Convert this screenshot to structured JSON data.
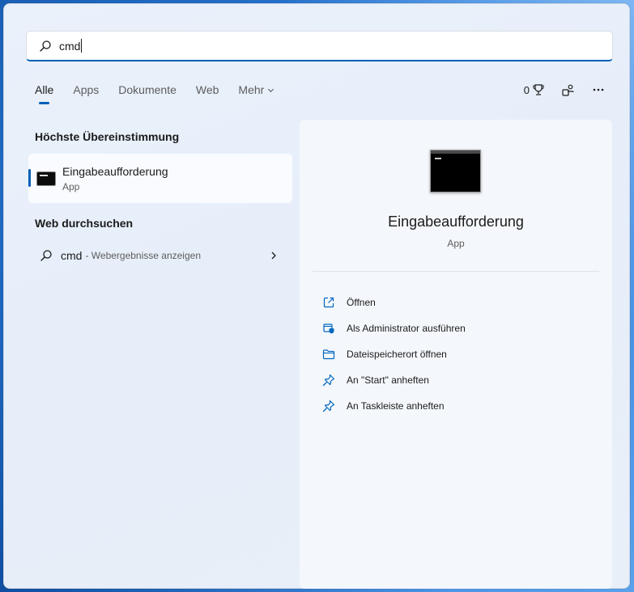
{
  "search": {
    "value": "cmd"
  },
  "tabs": [
    {
      "label": "Alle",
      "active": true
    },
    {
      "label": "Apps"
    },
    {
      "label": "Dokumente"
    },
    {
      "label": "Web"
    },
    {
      "label": "Mehr",
      "dropdown": true
    }
  ],
  "header_right": {
    "rewards_points": "0"
  },
  "best_match": {
    "heading": "Höchste Übereinstimmung",
    "title": "Eingabeaufforderung",
    "subtitle": "App"
  },
  "web_search": {
    "heading": "Web durchsuchen",
    "query": "cmd",
    "suffix": "- Webergebnisse anzeigen"
  },
  "preview": {
    "title": "Eingabeaufforderung",
    "subtitle": "App",
    "actions": [
      {
        "label": "Öffnen",
        "icon": "open-icon"
      },
      {
        "label": "Als Administrator ausführen",
        "icon": "admin-shield-icon"
      },
      {
        "label": "Dateispeicherort öffnen",
        "icon": "folder-icon"
      },
      {
        "label": "An \"Start\" anheften",
        "icon": "pin-icon"
      },
      {
        "label": "An Taskleiste anheften",
        "icon": "pin-icon"
      }
    ]
  },
  "colors": {
    "accent": "#005fb8",
    "icon_blue": "#0067c0"
  }
}
